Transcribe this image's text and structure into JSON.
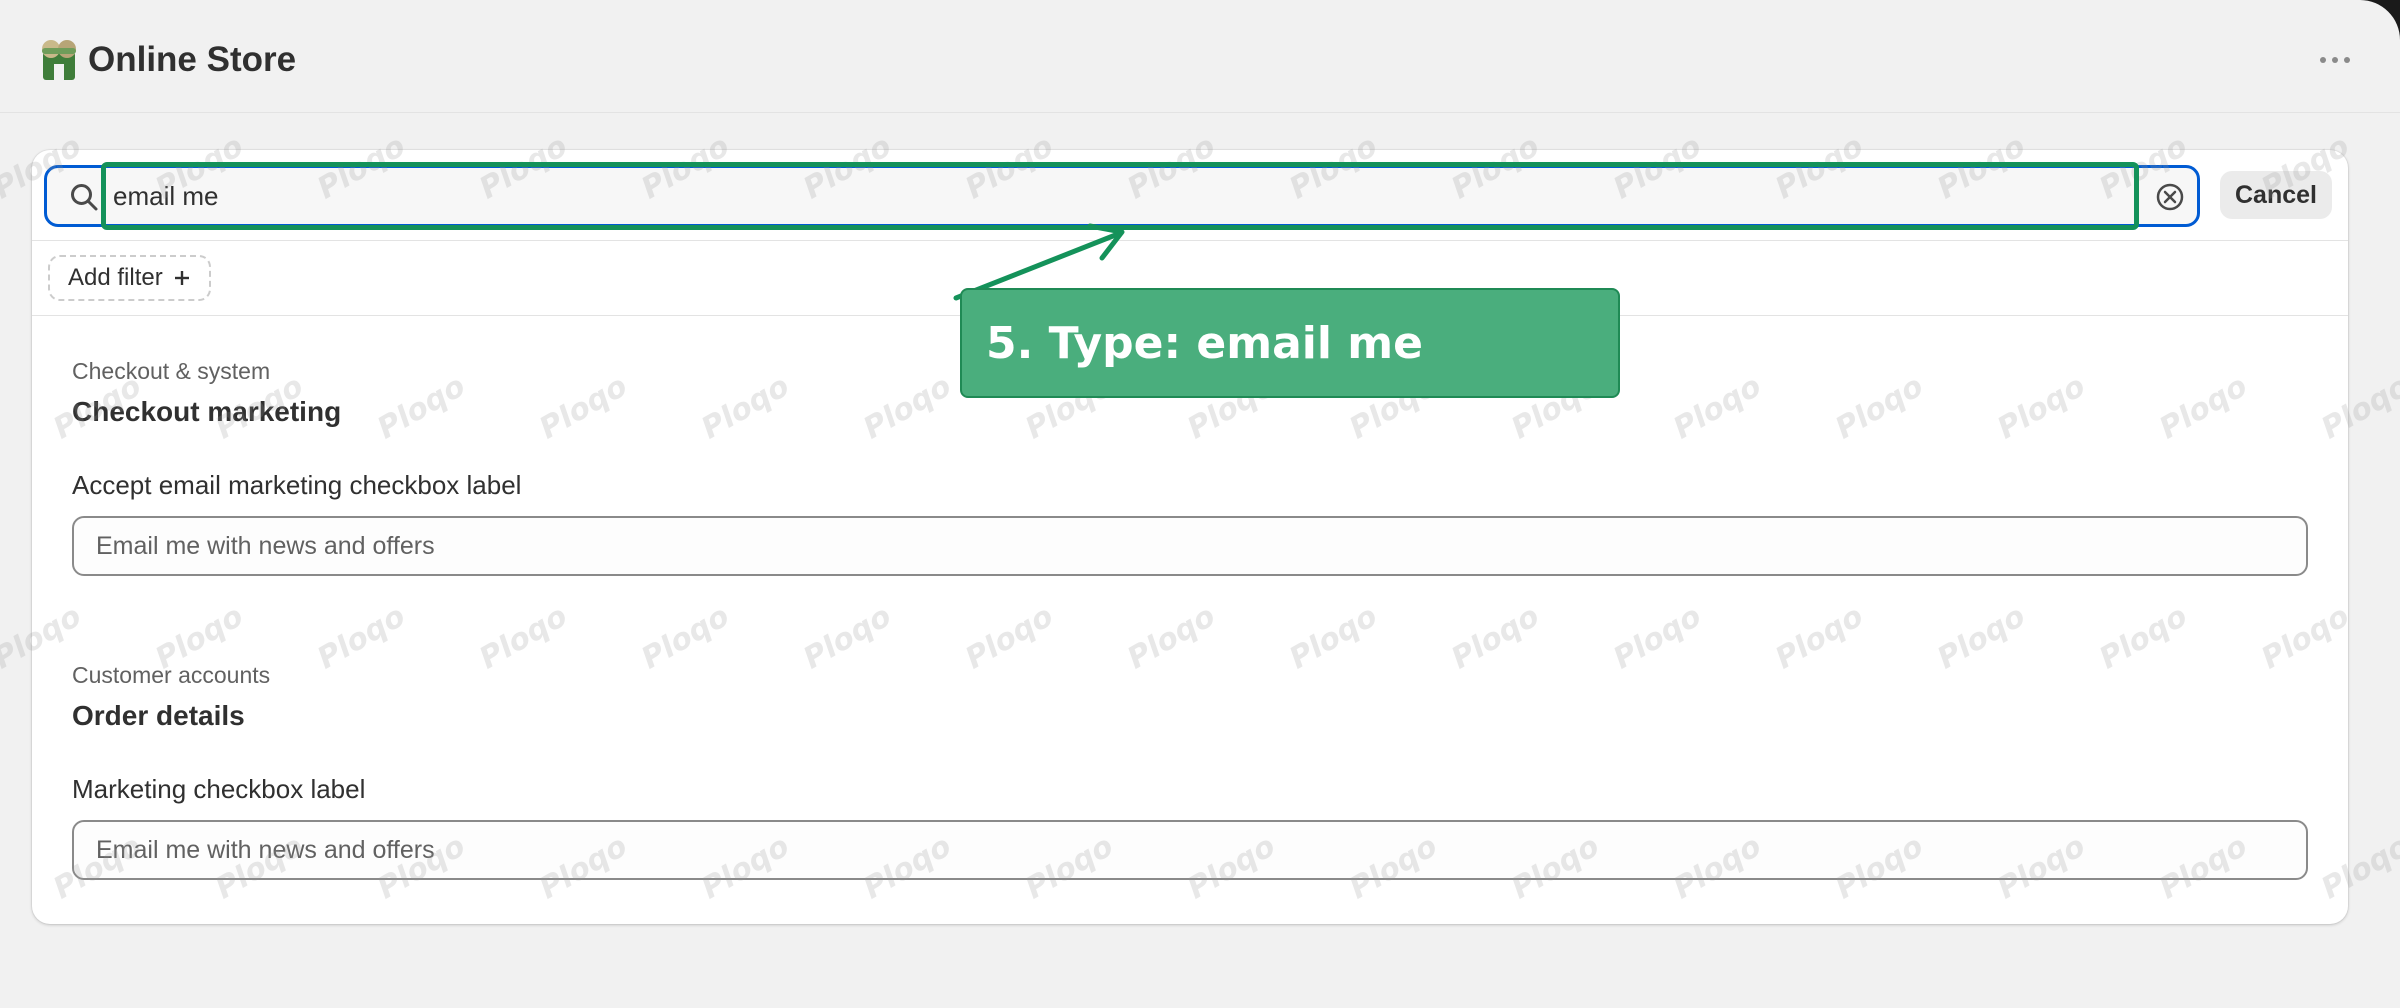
{
  "app": {
    "title": "Online Store",
    "icon": "store-icon"
  },
  "header": {
    "more_icon": "ellipsis-icon"
  },
  "search": {
    "value": "email me",
    "clear_icon": "clear-circle-icon",
    "cancel_label": "Cancel"
  },
  "filters": {
    "add_label": "Add filter",
    "add_icon": "plus-icon"
  },
  "results": [
    {
      "category": "Checkout & system",
      "title": "Checkout marketing",
      "field_label": "Accept email marketing checkbox label",
      "field_value": "Email me with news and offers"
    },
    {
      "category": "Customer accounts",
      "title": "Order details",
      "field_label": "Marketing checkbox label",
      "field_value": "Email me with news and offers"
    }
  ],
  "annotation": {
    "step_text": "5. Type: email me"
  },
  "watermark": "Ploqo",
  "colors": {
    "focus_blue": "#005bd3",
    "highlight_green": "#14925a",
    "callout_green": "#4aae7d"
  }
}
